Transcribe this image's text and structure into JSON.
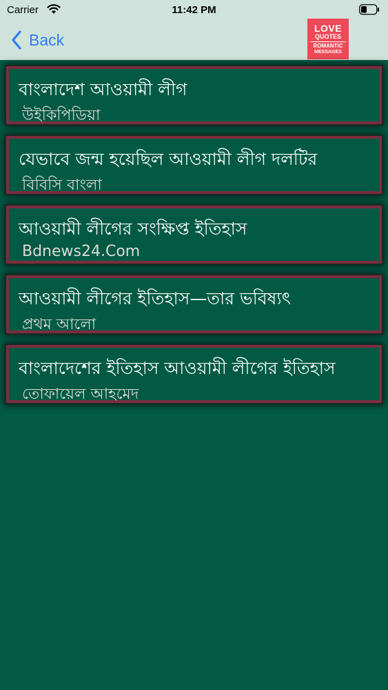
{
  "status": {
    "carrier": "Carrier",
    "time": "11:42 PM",
    "icons": [
      "wifi-icon",
      "battery-icon"
    ]
  },
  "nav": {
    "back_label": "Back",
    "back_icon": "chevron-left-icon",
    "back_color": "#2f7cf6",
    "logo": {
      "line1": "LOVE",
      "line2": "QUOTES",
      "line3": "ROMANTIC",
      "line4": "MESSAGES",
      "color": "#ec4a57"
    }
  },
  "colors": {
    "background": "#035a44",
    "nav_background": "#cfe3dc",
    "item_border": "#7b2d40"
  },
  "items": [
    {
      "title": "বাংলাদেশ আওয়ামী লীগ",
      "source": "উইকিপিডিয়া"
    },
    {
      "title": "যেভাবে জন্ম হয়েছিল আওয়ামী লীগ দলটির",
      "source": "বিবিসি বাংলা"
    },
    {
      "title": "আওয়ামী লীগের সংক্ষিপ্ত ইতিহাস",
      "source": "Bdnews24.Com"
    },
    {
      "title": "আওয়ামী লীগের ইতিহাস—তার ভবিষ্যৎ",
      "source": "প্রথম আলো"
    },
    {
      "title": "বাংলাদেশের ইতিহাস আওয়ামী লীগের ইতিহাস",
      "source": "তোফায়েল আহমেদ"
    }
  ]
}
